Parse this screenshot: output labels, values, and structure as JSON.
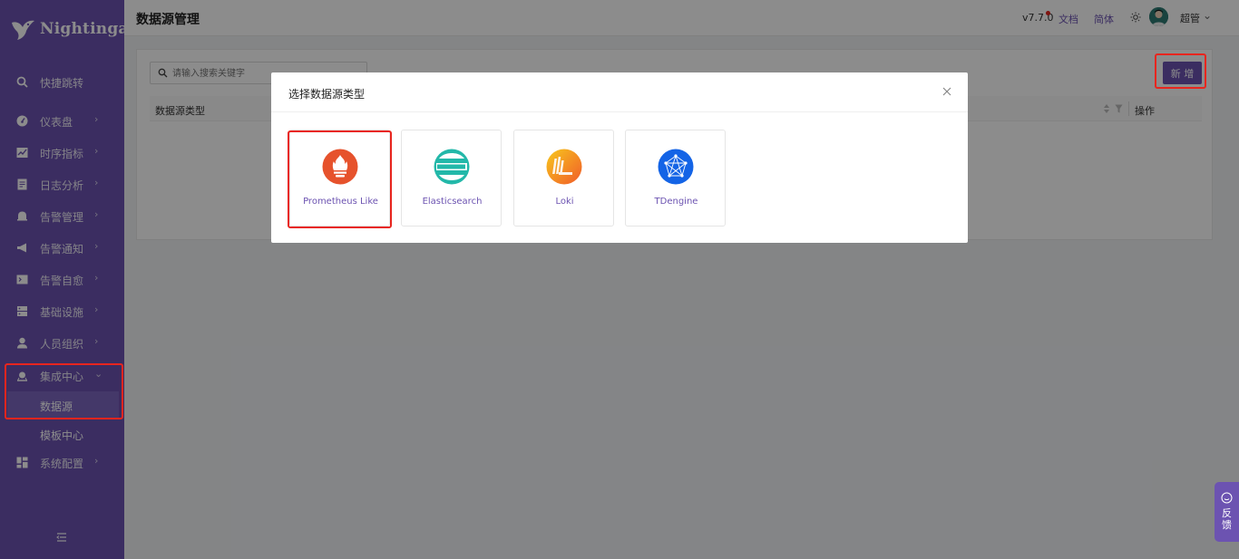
{
  "app": {
    "name": "Nightingale"
  },
  "sidebar": {
    "items": [
      {
        "label": "快捷跳转",
        "icon": "search-icon",
        "chevron": ""
      },
      {
        "label": "仪表盘",
        "icon": "dashboard-icon",
        "chevron": "›"
      },
      {
        "label": "时序指标",
        "icon": "line-chart-icon",
        "chevron": "›"
      },
      {
        "label": "日志分析",
        "icon": "log-icon",
        "chevron": "›"
      },
      {
        "label": "告警管理",
        "icon": "alert-bell-icon",
        "chevron": "›"
      },
      {
        "label": "告警通知",
        "icon": "megaphone-icon",
        "chevron": "›"
      },
      {
        "label": "告警自愈",
        "icon": "terminal-icon",
        "chevron": "›"
      },
      {
        "label": "基础设施",
        "icon": "server-icon",
        "chevron": "›"
      },
      {
        "label": "人员组织",
        "icon": "user-icon",
        "chevron": "›"
      },
      {
        "label": "集成中心",
        "icon": "integration-icon",
        "chevron": "⌄"
      }
    ],
    "sub_items": [
      {
        "label": "数据源",
        "active": true
      },
      {
        "label": "模板中心",
        "active": false
      }
    ],
    "bottom_item": {
      "label": "系统配置",
      "icon": "grid-icon",
      "chevron": "›"
    }
  },
  "header": {
    "title": "数据源管理",
    "version": "v7.7.0",
    "docs_link": "文档",
    "lang_link": "简体",
    "username": "超管",
    "user_chevron": "⌄"
  },
  "content": {
    "search_placeholder": "请输入搜索关键字",
    "add_button": "新 增",
    "table": {
      "col_type": "数据源类型",
      "col_actions": "操作"
    }
  },
  "modal": {
    "title": "选择数据源类型",
    "options": [
      {
        "label": "Prometheus Like",
        "icon": "prometheus-icon",
        "selected": true
      },
      {
        "label": "Elasticsearch",
        "icon": "elasticsearch-icon",
        "selected": false
      },
      {
        "label": "Loki",
        "icon": "loki-icon",
        "selected": false
      },
      {
        "label": "TDengine",
        "icon": "tdengine-icon",
        "selected": false
      }
    ]
  },
  "feedback": {
    "label": "反馈"
  },
  "colors": {
    "brand": "#6c53b1",
    "highlight_border": "#e8251e"
  }
}
